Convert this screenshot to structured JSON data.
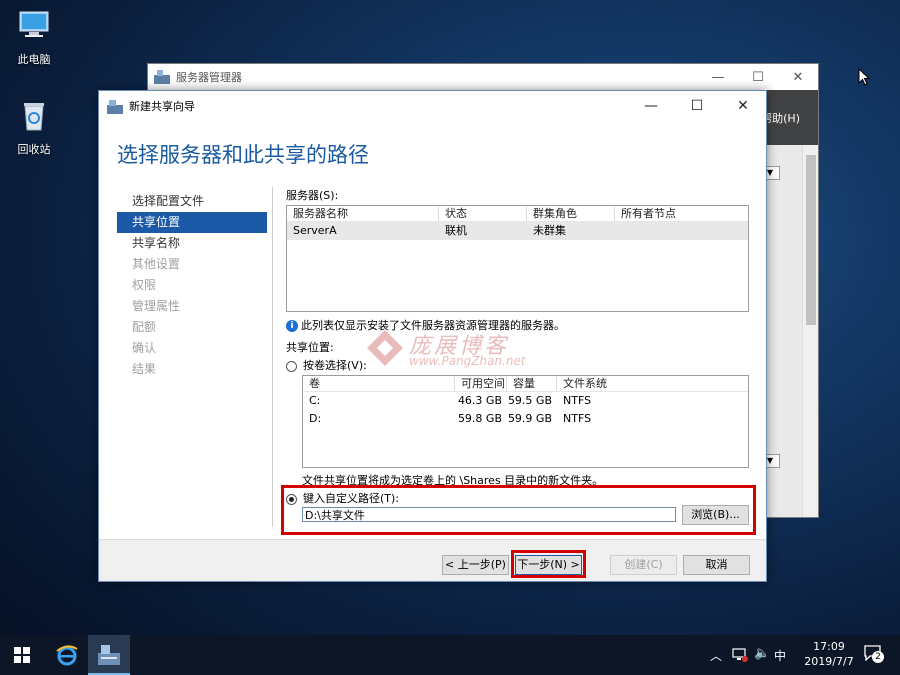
{
  "desktop": {
    "icons": [
      {
        "label": "此电脑"
      },
      {
        "label": "回收站"
      }
    ]
  },
  "server_manager": {
    "title": "服务器管理器",
    "help_menu": "帮助(H)"
  },
  "wizard": {
    "title": "新建共享向导",
    "heading": "选择服务器和此共享的路径",
    "nav": [
      {
        "label": "选择配置文件",
        "state": "done"
      },
      {
        "label": "共享位置",
        "state": "active"
      },
      {
        "label": "共享名称",
        "state": "next"
      },
      {
        "label": "其他设置",
        "state": "disabled"
      },
      {
        "label": "权限",
        "state": "disabled"
      },
      {
        "label": "管理属性",
        "state": "disabled"
      },
      {
        "label": "配额",
        "state": "disabled"
      },
      {
        "label": "确认",
        "state": "disabled"
      },
      {
        "label": "结果",
        "state": "disabled"
      }
    ],
    "servers": {
      "label": "服务器(S):",
      "columns": [
        "服务器名称",
        "状态",
        "群集角色",
        "所有者节点"
      ],
      "rows": [
        {
          "name": "ServerA",
          "status": "联机",
          "cluster_role": "未群集",
          "owner": ""
        }
      ],
      "info": "此列表仅显示安装了文件服务器资源管理器的服务器。"
    },
    "share_location": {
      "label": "共享位置:",
      "by_volume_label": "按卷选择(V):",
      "volume_columns": [
        "卷",
        "可用空间",
        "容量",
        "文件系统"
      ],
      "volumes": [
        {
          "volume": "C:",
          "free": "46.3 GB",
          "capacity": "59.5 GB",
          "fs": "NTFS"
        },
        {
          "volume": "D:",
          "free": "59.8 GB",
          "capacity": "59.9 GB",
          "fs": "NTFS"
        }
      ],
      "note": "文件共享位置将成为选定卷上的 \\Shares 目录中的新文件夹。",
      "custom_path_label": "键入自定义路径(T):",
      "custom_path_value": "D:\\共享文件",
      "browse_label": "浏览(B)...",
      "selected": "custom"
    },
    "buttons": {
      "prev": "< 上一步(P)",
      "next": "下一步(N) >",
      "create": "创建(C)",
      "cancel": "取消"
    }
  },
  "watermark": {
    "text": "庞展博客",
    "url": "www.PangZhan.net"
  },
  "taskbar": {
    "ime": "中",
    "time": "17:09",
    "date": "2019/7/7",
    "notification_count": "2"
  },
  "colors": {
    "accent": "#1c5aa8",
    "heading": "#1a5aa0",
    "highlight": "#d40000"
  }
}
